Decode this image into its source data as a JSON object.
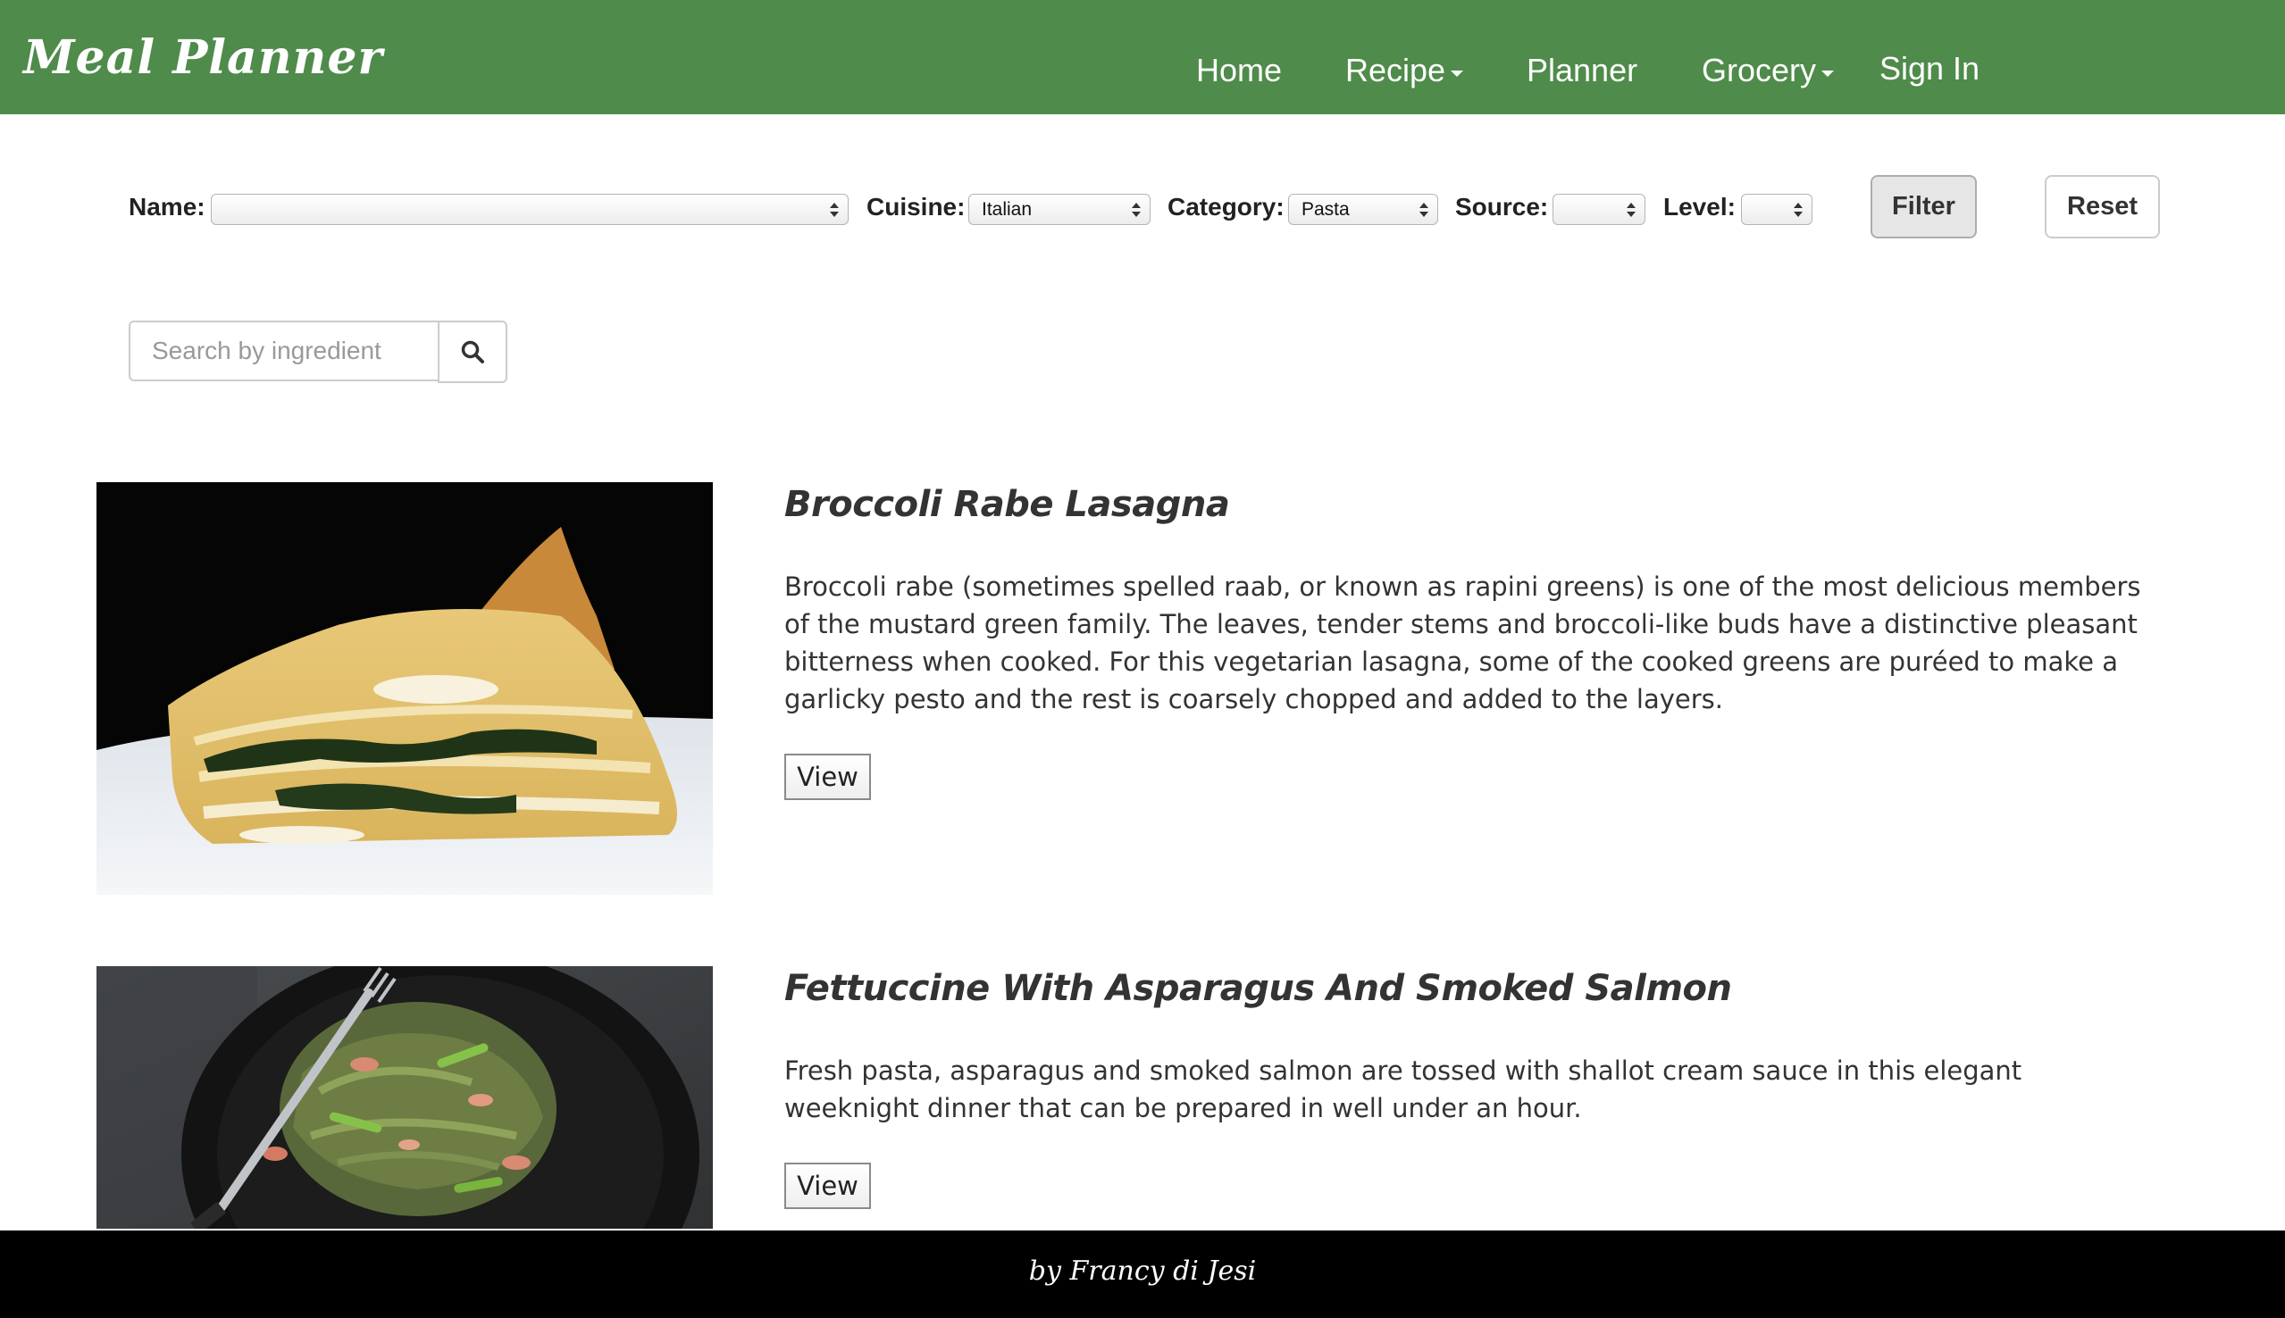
{
  "nav": {
    "brand": "Meal Planner",
    "items": [
      {
        "label": "Home"
      },
      {
        "label": "Recipe"
      },
      {
        "label": "Planner"
      },
      {
        "label": "Grocery"
      },
      {
        "label": "Sign In"
      }
    ]
  },
  "filters": {
    "name_label": "Name:",
    "name_value": "",
    "cuisine_label": "Cuisine:",
    "cuisine_value": "Italian",
    "category_label": "Category:",
    "category_value": "Pasta",
    "source_label": "Source:",
    "source_value": "",
    "level_label": "Level:",
    "level_value": "",
    "filter_button": "Filter",
    "reset_button": "Reset"
  },
  "search": {
    "placeholder": "Search by ingredient"
  },
  "recipes": [
    {
      "title": "Broccoli Rabe Lasagna",
      "description": "Broccoli rabe (sometimes spelled raab, or known as rapini greens) is one of the most delicious members of the mustard green family. The leaves, tender stems and broccoli-like buds have a distinctive pleasant bitterness when cooked. For this vegetarian lasagna, some of the cooked greens are puréed to make a garlicky pesto and the rest is coarsely chopped and added to the layers.",
      "button": "View"
    },
    {
      "title": "Fettuccine With Asparagus And Smoked Salmon",
      "description": "Fresh pasta, asparagus and smoked salmon are tossed with shallot cream sauce in this elegant weeknight dinner that can be prepared in well under an hour.",
      "button": "View"
    }
  ],
  "footer": {
    "credit": "by Francy di Jesi"
  },
  "colors": {
    "navbar": "#4f8b4a",
    "footer": "#000000",
    "text": "#333333"
  }
}
